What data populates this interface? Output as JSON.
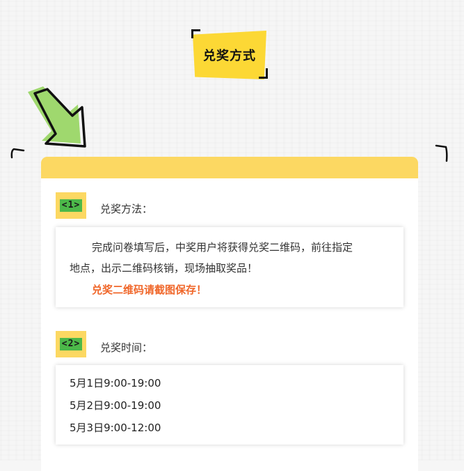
{
  "title": "兑奖方式",
  "sections": [
    {
      "number": "<1>",
      "label": "兑奖方法：",
      "paragraph_line1": "完成问卷填写后，中奖用户将获得兑奖二维码，前往指定",
      "paragraph_line2": "地点，出示二维码核销，现场抽取奖品！",
      "highlight": "兑奖二维码请截图保存！"
    },
    {
      "number": "<2>",
      "label": "兑奖时间：",
      "times": [
        "5月1日9:00-19:00",
        "5月2日9:00-19:00",
        "5月3日9:00-12:00"
      ]
    }
  ],
  "colors": {
    "yellow": "#fcd862",
    "green": "#4cb849",
    "highlight": "#f0672a"
  },
  "icons": [
    "arrow-pointer-icon"
  ]
}
